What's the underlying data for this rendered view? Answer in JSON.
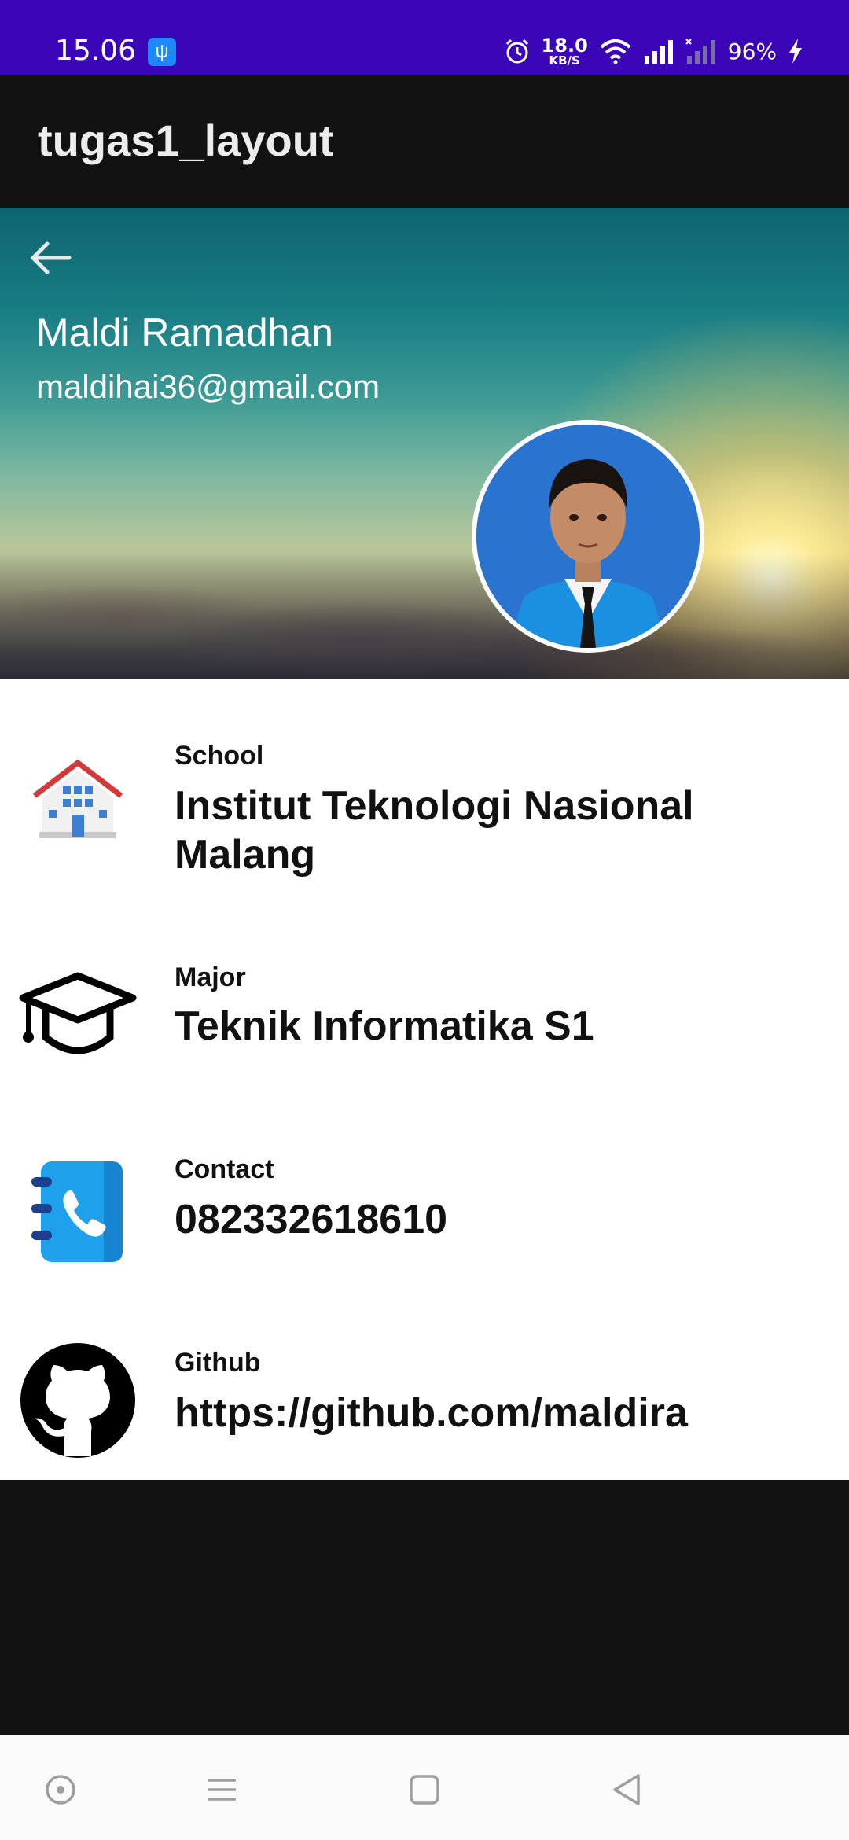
{
  "status_bar": {
    "time": "15.06",
    "speed_value": "18.0",
    "speed_unit": "KB/S",
    "battery": "96%"
  },
  "app_bar": {
    "title": "tugas1_layout"
  },
  "profile": {
    "name": "Maldi Ramadhan",
    "email": "maldihai36@gmail.com"
  },
  "details": [
    {
      "label": "School",
      "value": "Institut Teknologi Nasional Malang",
      "icon": "school-icon"
    },
    {
      "label": "Major",
      "value": "Teknik Informatika S1",
      "icon": "graduation-cap-icon"
    },
    {
      "label": "Contact",
      "value": "082332618610",
      "icon": "contact-book-icon"
    },
    {
      "label": "Github",
      "value": "https://github.com/maldira",
      "icon": "github-icon"
    }
  ],
  "nav_bar": {
    "buttons": [
      "dot-button",
      "menu-button",
      "home-button",
      "back-button"
    ]
  },
  "colors": {
    "status_bar": "#3a06b8",
    "app_bar": "#121212",
    "contact_icon": "#1ea0ea"
  }
}
